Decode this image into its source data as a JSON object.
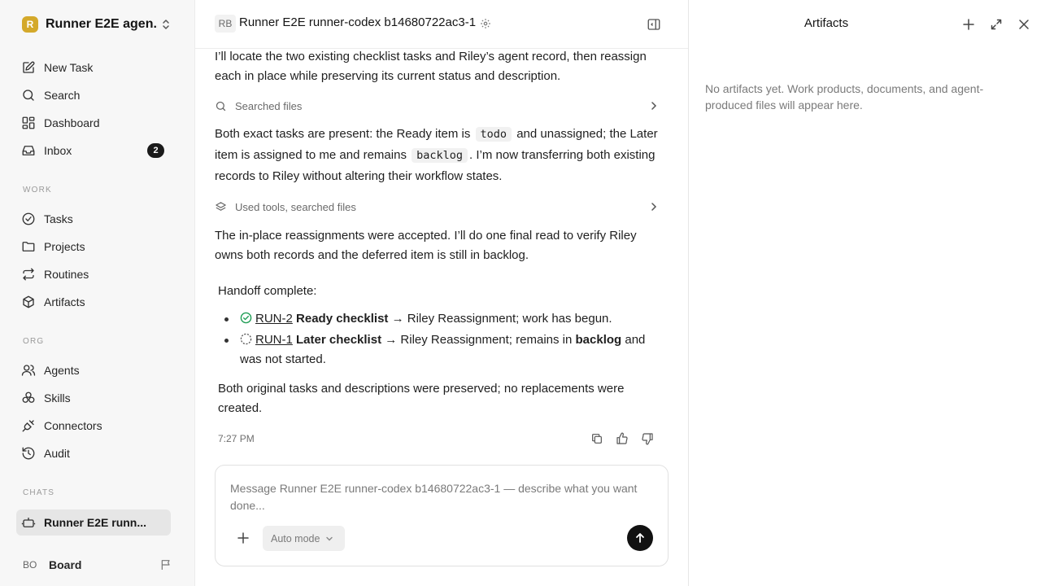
{
  "workspace": {
    "logo_letter": "R",
    "name": "Runner E2E agen..."
  },
  "nav_primary": [
    {
      "label": "New Task",
      "icon": "edit-icon"
    },
    {
      "label": "Search",
      "icon": "search-icon"
    },
    {
      "label": "Dashboard",
      "icon": "dashboard-icon"
    },
    {
      "label": "Inbox",
      "icon": "inbox-icon",
      "badge": "2"
    }
  ],
  "sections": {
    "work": "WORK",
    "org": "ORG",
    "chats": "CHATS"
  },
  "nav_work": [
    {
      "label": "Tasks",
      "icon": "check-circle-icon"
    },
    {
      "label": "Projects",
      "icon": "folder-icon"
    },
    {
      "label": "Routines",
      "icon": "repeat-icon"
    },
    {
      "label": "Artifacts",
      "icon": "box-icon"
    }
  ],
  "nav_org": [
    {
      "label": "Agents",
      "icon": "users-icon"
    },
    {
      "label": "Skills",
      "icon": "skills-icon"
    },
    {
      "label": "Connectors",
      "icon": "plug-icon"
    },
    {
      "label": "Audit",
      "icon": "history-icon"
    }
  ],
  "chat_item": {
    "label": "Runner E2E runn..."
  },
  "user": {
    "initials": "BO",
    "name": "Board"
  },
  "header": {
    "initials": "RB",
    "title": "Runner E2E runner-codex b14680722ac3-1"
  },
  "conversation": {
    "msg1": "I’ll locate the two existing checklist tasks and Riley’s agent record, then reassign each in place while preserving its current status and description.",
    "tool1": "Searched files",
    "msg2": {
      "part1": "Both exact tasks are present: the Ready item is",
      "code1": "todo",
      "part2": "and unassigned; the Later item is assigned to me and remains",
      "code2": "backlog",
      "part3": ". I’m now transferring both existing records to Riley without altering their workflow states."
    },
    "tool2": "Used tools, searched files",
    "msg3": "The in-place reassignments were accepted. I’ll do one final read to verify Riley owns both records and the deferred item is still in backlog.",
    "handoff_heading": "Handoff complete:",
    "items": [
      {
        "id": "RUN-2",
        "title": "Ready checklist",
        "text": "→ Riley Reassignment; work has begun.",
        "status": "done"
      },
      {
        "id": "RUN-1",
        "title": "Later checklist",
        "text_before": "→ Riley Reassignment; remains in",
        "bold": "backlog",
        "text_after": "and was not started.",
        "status": "backlog"
      }
    ],
    "closing": "Both original tasks and descriptions were preserved; no replacements were created.",
    "time": "7:27 PM"
  },
  "composer": {
    "placeholder": "Message Runner E2E runner-codex b14680722ac3-1 — describe what you want done...",
    "mode": "Auto mode"
  },
  "artifacts": {
    "title": "Artifacts",
    "empty_text": "No artifacts yet. Work products, documents, and agent-produced files will appear here."
  }
}
